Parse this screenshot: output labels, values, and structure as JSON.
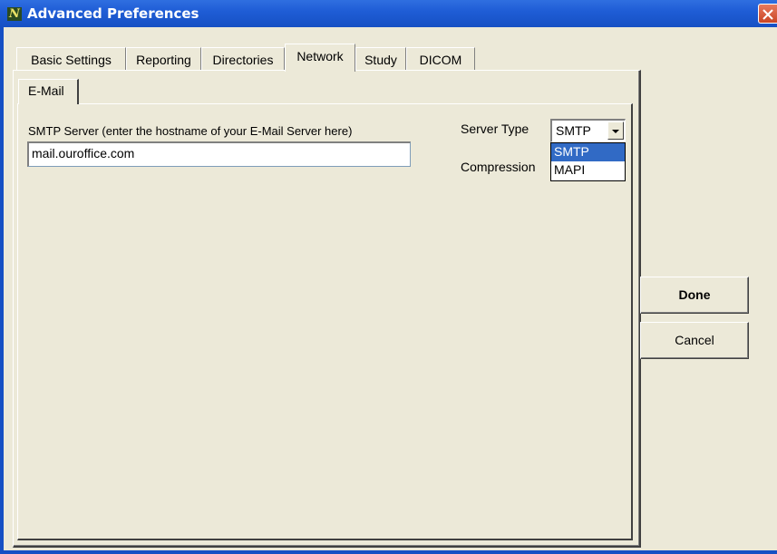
{
  "window": {
    "title": "Advanced Preferences",
    "app_icon_letter": "N"
  },
  "tabs": [
    {
      "label": "Basic Settings",
      "active": false
    },
    {
      "label": "Reporting",
      "active": false
    },
    {
      "label": "Directories",
      "active": false
    },
    {
      "label": "Network",
      "active": true
    },
    {
      "label": "Study",
      "active": false
    },
    {
      "label": "DICOM",
      "active": false
    }
  ],
  "subtabs": [
    {
      "label": "E-Mail",
      "active": true
    }
  ],
  "email": {
    "smtp_label": "SMTP Server (enter the hostname of your E-Mail Server here)",
    "smtp_value": "mail.ouroffice.com",
    "server_type_label": "Server Type",
    "server_type_value": "SMTP",
    "server_type_options": [
      "SMTP",
      "MAPI"
    ],
    "compression_label": "Compression"
  },
  "buttons": {
    "done": "Done",
    "cancel": "Cancel"
  }
}
